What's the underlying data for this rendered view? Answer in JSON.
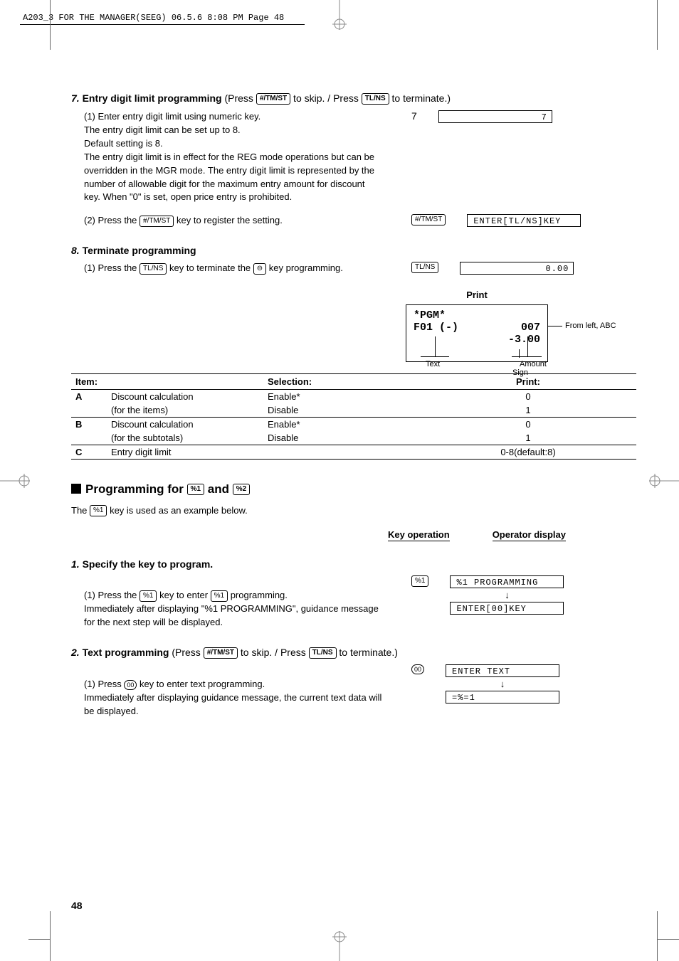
{
  "header": "A203_3 FOR THE MANAGER(SEEG)  06.5.6 8:08 PM  Page 48",
  "s7": {
    "title_prefix": "7.",
    "title": " Entry digit limit programming ",
    "title_suffix_a": "(Press ",
    "key1": "#/TM/ST",
    "title_mid": " to skip. / Press ",
    "key2": "TL/NS",
    "title_end": " to terminate.)",
    "step1": "(1) Enter entry digit limit using numeric key.\nThe entry digit limit can be set up to 8.\nDefault setting is 8.\nThe entry digit limit is in effect for the REG mode operations but can be overridden in the MGR mode. The entry digit limit is represented by the number of allowable digit for the maximum entry amount for discount key.  When \"0\" is set, open price entry is prohibited.",
    "step1_num": "7",
    "step1_disp": "7",
    "step2_a": "(2) Press the ",
    "step2_key": "#/TM/ST",
    "step2_b": " key to register the setting.",
    "step2_rkey": "#/TM/ST",
    "step2_disp": "ENTER[TL/NS]KEY"
  },
  "s8": {
    "title_prefix": "8.",
    "title": " Terminate programming",
    "step1_a": "(1) Press the ",
    "step1_key": "TL/NS",
    "step1_b": " key to terminate the ",
    "step1_c": " key programming.",
    "step1_rkey": "TL/NS",
    "step1_disp": "0.00",
    "minus": "⊖"
  },
  "print": {
    "label": "Print",
    "r1": "*PGM*",
    "r2a": "F01 (-)",
    "r2b": "007",
    "r3": "-3.00",
    "anno_right": "From left, ABC",
    "anno_text": "Text",
    "anno_sign": "Sign",
    "anno_amount": "Amount"
  },
  "table": {
    "h_item": "Item:",
    "h_sel": "Selection:",
    "h_print": "Print:",
    "rows": [
      {
        "k": "A",
        "d": "Discount calculation",
        "s": "Enable*",
        "p": "0"
      },
      {
        "k": "",
        "d": "(for the items)",
        "s": "Disable",
        "p": "1"
      },
      {
        "k": "B",
        "d": "Discount calculation",
        "s": "Enable*",
        "p": "0"
      },
      {
        "k": "",
        "d": "(for the subtotals)",
        "s": "Disable",
        "p": "1"
      },
      {
        "k": "C",
        "d": "Entry digit limit",
        "s": "",
        "p": "0-8(default:8)"
      }
    ]
  },
  "prog": {
    "heading_a": "Programming for ",
    "k1": "%1",
    "heading_b": " and ",
    "k2": "%2",
    "line_a": "The ",
    "line_b": " key is used as an example below.",
    "kop": "Key operation",
    "opd": "Operator display"
  },
  "p1": {
    "title_prefix": "1.",
    "title": " Specify the key to program.",
    "s_a": "(1) Press the ",
    "s_b": " key to enter ",
    "s_c": " programming.\nImmediately after displaying \"%1 PROGRAMMING\", guidance message for the next step will be displayed.",
    "key": "%1",
    "rkey": "%1",
    "disp1": "%1 PROGRAMMING",
    "disp2": "ENTER[00]KEY"
  },
  "p2": {
    "title_prefix": "2.",
    "title": " Text programming ",
    "title_suffix_a": "(Press ",
    "key1": "#/TM/ST",
    "title_mid": " to skip. / Press ",
    "key2": "TL/NS",
    "title_end": " to terminate.)",
    "s_a": "(1) Press ",
    "s_b": " key to enter text programming.\nImmediately after displaying guidance message, the current text data will be displayed.",
    "key00": "00",
    "rkey": "00",
    "disp1": "ENTER TEXT",
    "disp2": "=%=1"
  },
  "arrow": "↓",
  "page": "48"
}
